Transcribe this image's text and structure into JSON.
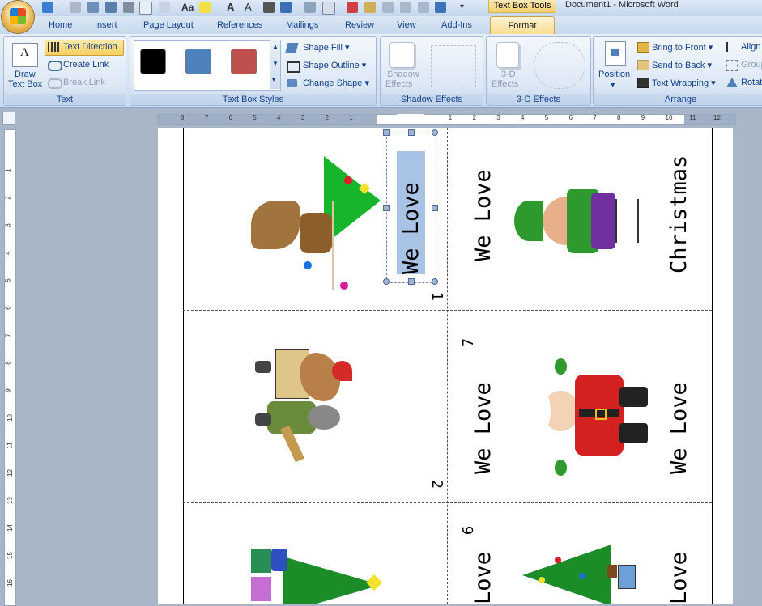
{
  "window": {
    "title": "Document1 - Microsoft Word",
    "contextual_tab_group": "Text Box Tools"
  },
  "tabs": [
    "Home",
    "Insert",
    "Page Layout",
    "References",
    "Mailings",
    "Review",
    "View",
    "Add-Ins",
    "Format"
  ],
  "active_tab": "Format",
  "ribbon": {
    "text_group": {
      "label": "Text",
      "draw_text_box_1": "Draw",
      "draw_text_box_2": "Text Box",
      "text_direction": "Text Direction",
      "create_link": "Create Link",
      "break_link": "Break Link"
    },
    "styles_group": {
      "label": "Text Box Styles",
      "swatches": [
        "#000000",
        "#4f81bd",
        "#c0504d"
      ],
      "shape_fill": "Shape Fill",
      "shape_outline": "Shape Outline",
      "change_shape": "Change Shape"
    },
    "shadow_group": {
      "label": "Shadow Effects",
      "shadow_effects_1": "Shadow",
      "shadow_effects_2": "Effects"
    },
    "threed_group": {
      "label": "3-D Effects",
      "effects_1": "3-D",
      "effects_2": "Effects"
    },
    "arrange_group": {
      "label": "Arrange",
      "position": "Position",
      "bring_to_front": "Bring to Front",
      "send_to_back": "Send to Back",
      "text_wrapping": "Text Wrapping",
      "align": "Align",
      "group": "Group",
      "rotate": "Rotate"
    }
  },
  "ruler_numbers": [
    "8",
    "7",
    "6",
    "5",
    "4",
    "3",
    "2",
    "1",
    "1",
    "2",
    "3",
    "4",
    "5",
    "6",
    "7",
    "8",
    "9",
    "10",
    "11",
    "12"
  ],
  "vruler_numbers": [
    "1",
    "2",
    "3",
    "4",
    "5",
    "6",
    "7",
    "8",
    "9",
    "10",
    "11",
    "12",
    "13",
    "14",
    "15",
    "16"
  ],
  "document": {
    "cells": [
      {
        "text": "We Love",
        "page": "1",
        "selected": true
      },
      {
        "text": "We Love",
        "text2": "Christmas"
      },
      {
        "text": "We Love",
        "page": "2"
      },
      {
        "text": "We Love",
        "text2": "We Love",
        "page": "7"
      },
      {
        "text": "Love",
        "text2": "Love",
        "page": "6"
      }
    ]
  }
}
